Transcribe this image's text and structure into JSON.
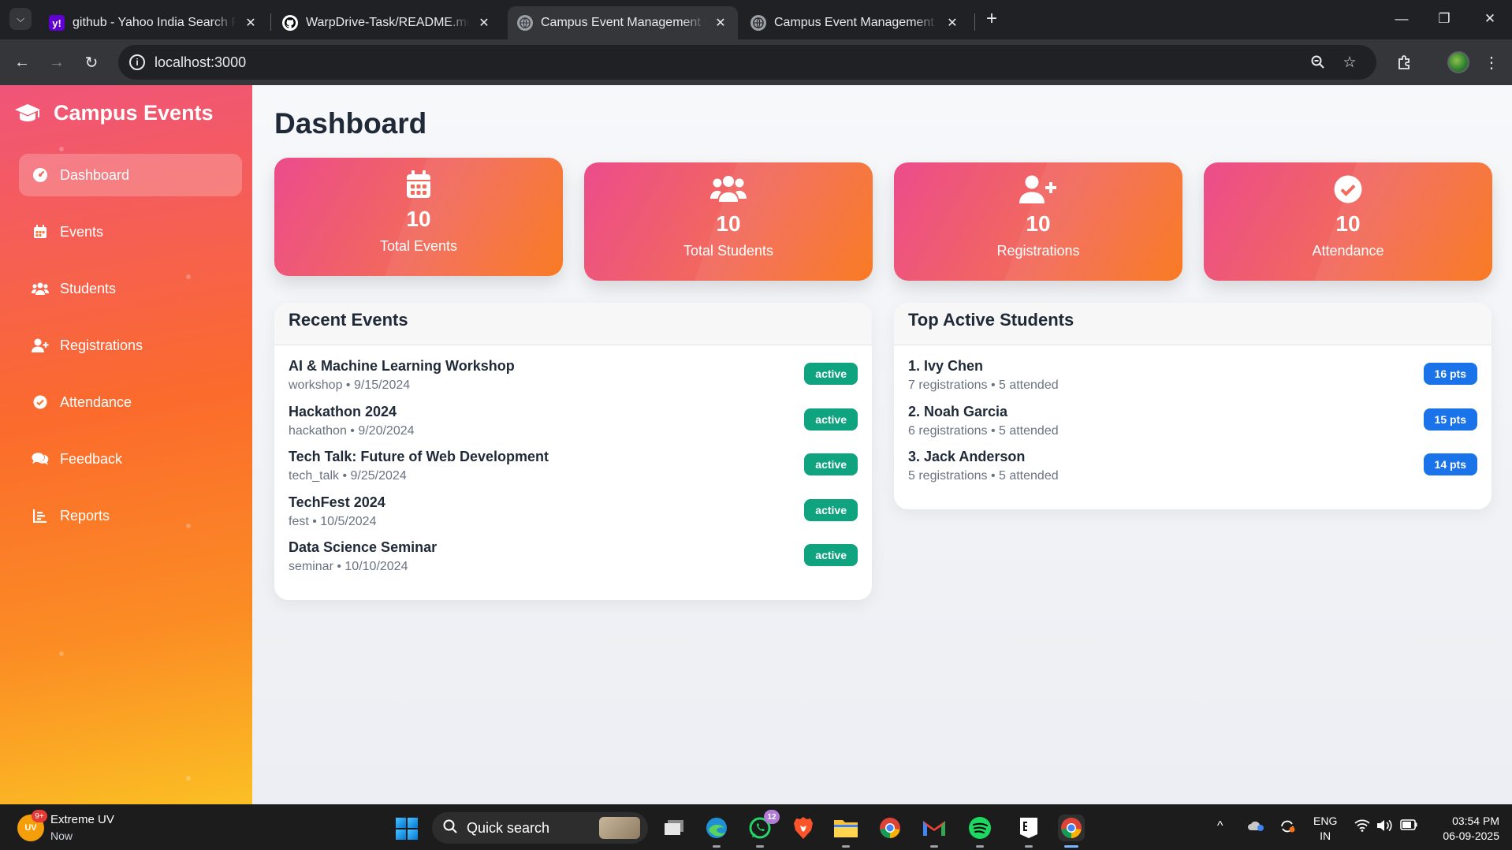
{
  "browser": {
    "tabs": [
      {
        "title": "github - Yahoo India Search Results",
        "favicon": "yahoo-icon"
      },
      {
        "title": "WarpDrive-Task/README.md at main",
        "favicon": "github-icon"
      },
      {
        "title": "Campus Event Management Platform",
        "favicon": "globe-icon",
        "active": true
      },
      {
        "title": "Campus Event Management - S",
        "favicon": "globe-icon"
      }
    ],
    "url": "localhost:3000"
  },
  "sidebar": {
    "brand": "Campus Events",
    "items": [
      {
        "label": "Dashboard",
        "icon": "dashboard-icon",
        "active": true
      },
      {
        "label": "Events",
        "icon": "calendar-icon"
      },
      {
        "label": "Students",
        "icon": "users-icon"
      },
      {
        "label": "Registrations",
        "icon": "user-plus-icon"
      },
      {
        "label": "Attendance",
        "icon": "check-circle-icon"
      },
      {
        "label": "Feedback",
        "icon": "comments-icon"
      },
      {
        "label": "Reports",
        "icon": "chart-icon"
      }
    ]
  },
  "main": {
    "title": "Dashboard",
    "stats": [
      {
        "value": "10",
        "label": "Total Events",
        "icon": "calendar-icon"
      },
      {
        "value": "10",
        "label": "Total Students",
        "icon": "users-icon"
      },
      {
        "value": "10",
        "label": "Registrations",
        "icon": "user-plus-icon"
      },
      {
        "value": "10",
        "label": "Attendance",
        "icon": "check-circle-icon"
      }
    ],
    "recent_events": {
      "title": "Recent Events",
      "items": [
        {
          "name": "AI & Machine Learning Workshop",
          "meta": "workshop • 9/15/2024",
          "status": "active"
        },
        {
          "name": "Hackathon 2024",
          "meta": "hackathon • 9/20/2024",
          "status": "active"
        },
        {
          "name": "Tech Talk: Future of Web Development",
          "meta": "tech_talk • 9/25/2024",
          "status": "active"
        },
        {
          "name": "TechFest 2024",
          "meta": "fest • 10/5/2024",
          "status": "active"
        },
        {
          "name": "Data Science Seminar",
          "meta": "seminar • 10/10/2024",
          "status": "active"
        }
      ]
    },
    "top_students": {
      "title": "Top Active Students",
      "items": [
        {
          "name": "1. Ivy Chen",
          "meta": "7 registrations • 5 attended",
          "points": "16 pts"
        },
        {
          "name": "2. Noah Garcia",
          "meta": "6 registrations • 5 attended",
          "points": "15 pts"
        },
        {
          "name": "3. Jack Anderson",
          "meta": "5 registrations • 5 attended",
          "points": "14 pts"
        }
      ]
    }
  },
  "taskbar": {
    "weather_title": "Extreme UV",
    "weather_sub": "Now",
    "weather_badge": "9+",
    "weather_icon_text": "UV",
    "search_label": "Quick search",
    "whatsapp_badge": "12",
    "lang_top": "ENG",
    "lang_bottom": "IN",
    "time": "03:54 PM",
    "date": "06-09-2025"
  },
  "colors": {
    "accent_gradient_start": "#ec4c8c",
    "accent_gradient_end": "#f97316",
    "active_badge": "#10a37f",
    "points_badge": "#1a73e8"
  }
}
